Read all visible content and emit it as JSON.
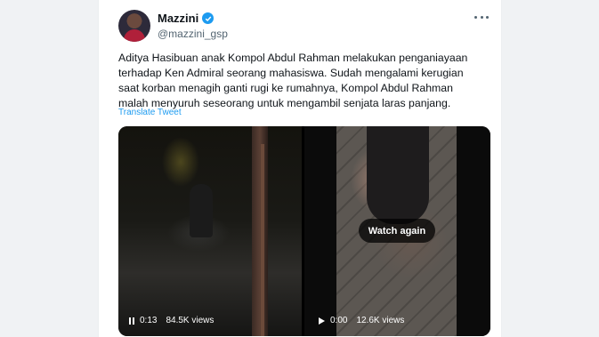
{
  "tweet": {
    "display_name": "Mazzini",
    "handle": "@mazzini_gsp",
    "text_lines": [
      "Aditya Hasibuan anak Kompol Abdul Rahman melakukan penganiayaan",
      "terhadap Ken Admiral seorang mahasiswa. Sudah mengalami kerugian",
      "saat korban menagih ganti rugi ke rumahnya, Kompol Abdul Rahman",
      "malah menyuruh seseorang untuk mengambil senjata laras panjang."
    ],
    "translate_label": "Translate Tweet"
  },
  "media": {
    "videos": [
      {
        "state": "playing",
        "time": "0:13",
        "views": "84.5K views"
      },
      {
        "state": "paused",
        "time": "0:00",
        "views": "12.6K views",
        "overlay": "Watch again"
      }
    ]
  },
  "colors": {
    "accent": "#1d9bf0",
    "text": "#0f1419",
    "muted": "#536471"
  },
  "icons": {
    "verified": "verified-badge-icon",
    "more": "more-options-icon",
    "pause": "pause-icon",
    "play": "play-icon"
  }
}
